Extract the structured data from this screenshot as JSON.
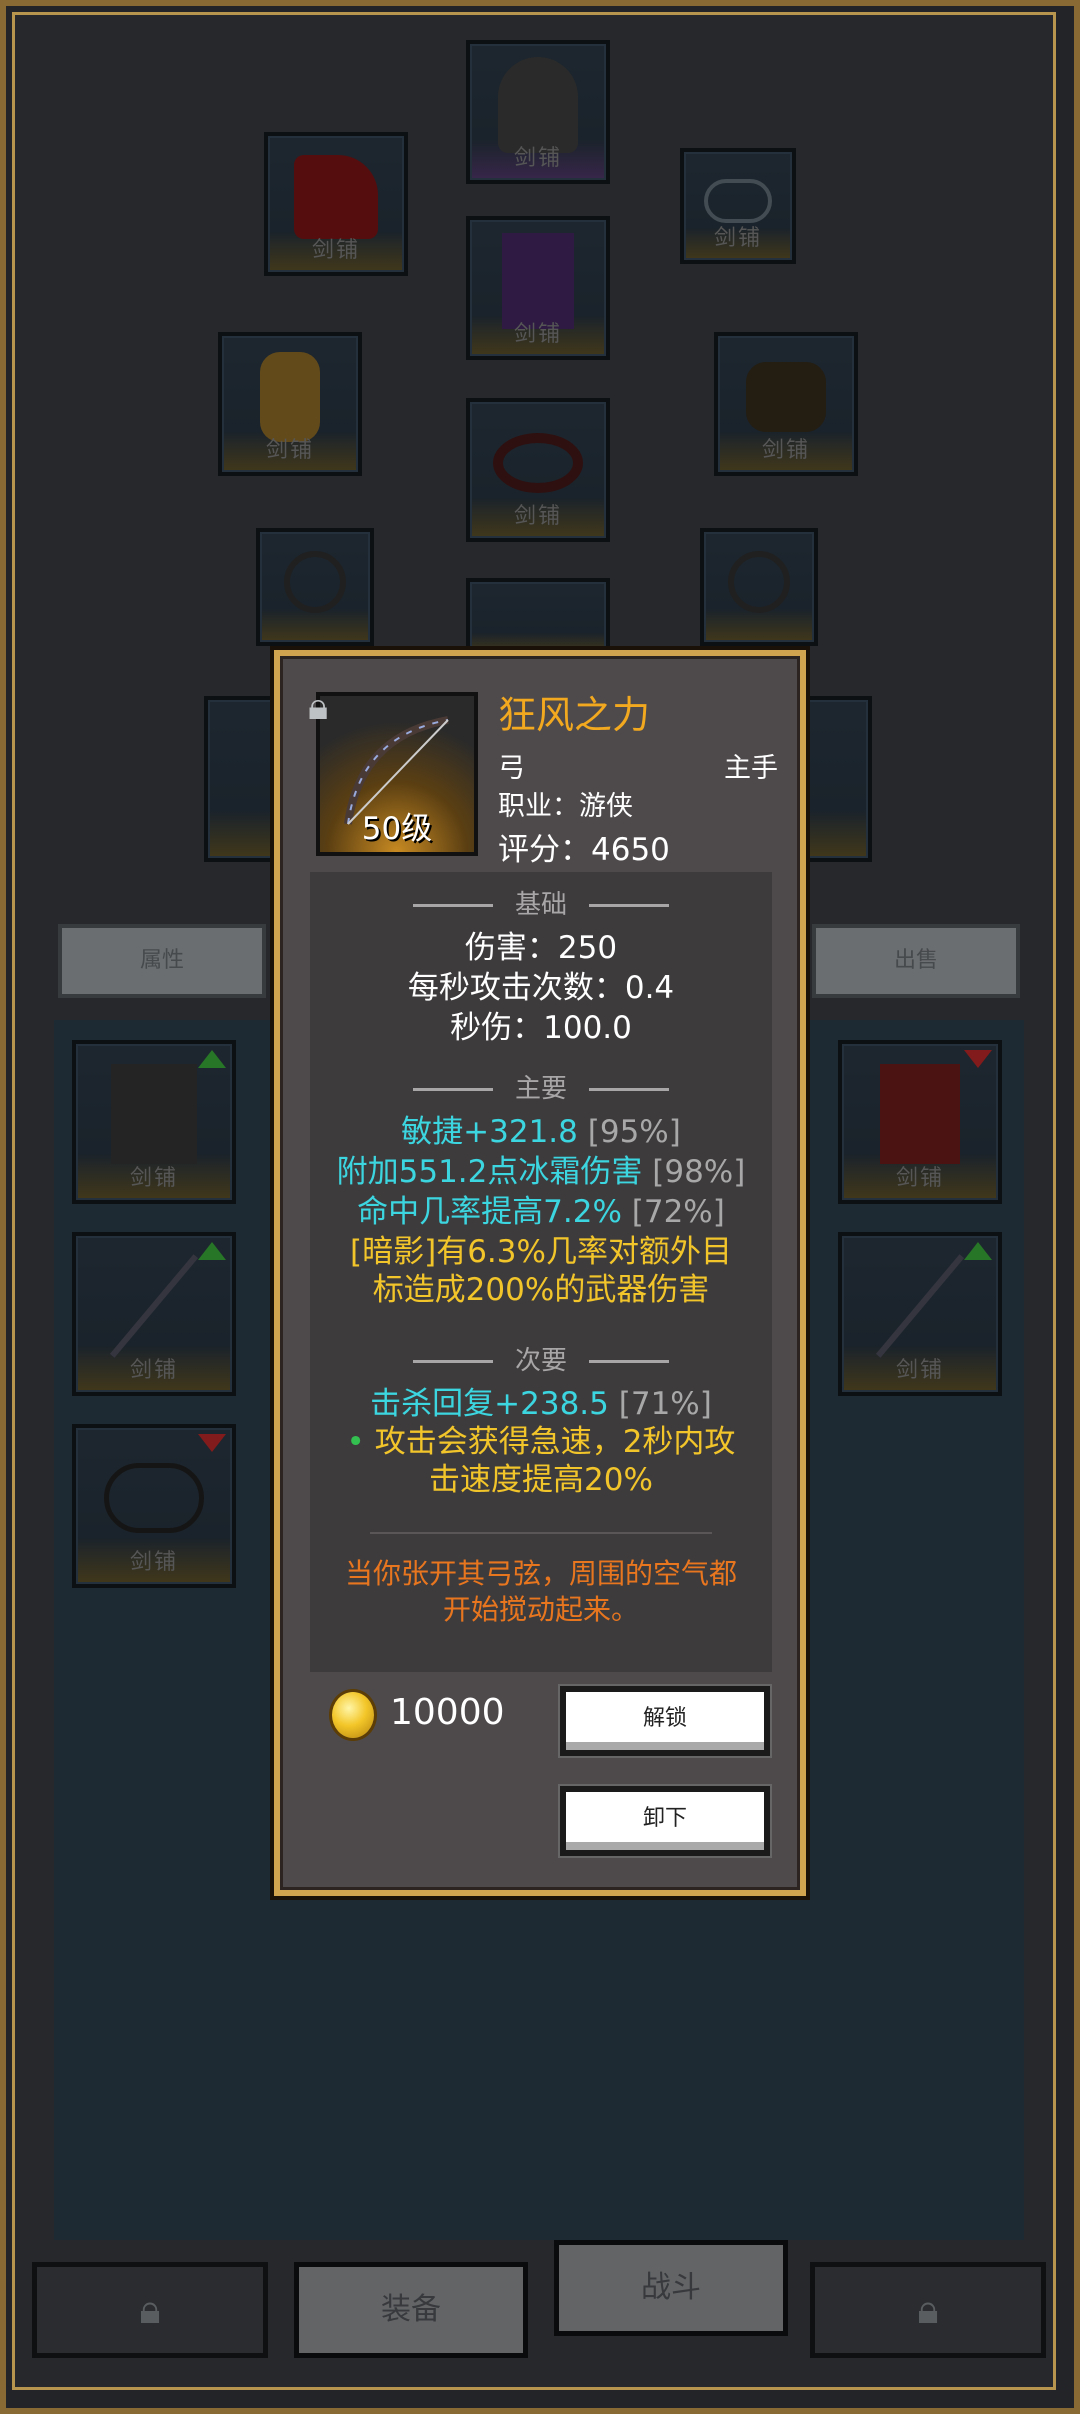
{
  "equipment_slots": {
    "slot_label": "剑铺",
    "top_helmet": "头盔",
    "arrows": {
      "up": "green",
      "down": "red"
    }
  },
  "side_tabs": {
    "left": "属性",
    "right": "出售"
  },
  "bottom_bar": {
    "equip": "装备",
    "battle": "战斗"
  },
  "item": {
    "name": "狂风之力",
    "type": "弓",
    "hand": "主手",
    "class_line": "职业：游侠",
    "score_line": "评分：4650",
    "level": "50级",
    "base_header": "基础",
    "base": [
      "伤害：250",
      "每秒攻击次数：0.4",
      "秒伤：100.0"
    ],
    "main_header": "主要",
    "main": [
      {
        "text": "敏捷+321.8",
        "pct": "[95%]"
      },
      {
        "text": "附加551.2点冰霜伤害",
        "pct": "[98%]"
      },
      {
        "text": "命中几率提高7.2%",
        "pct": "[72%]"
      }
    ],
    "special_line1": "[暗影]有6.3%几率对额外目",
    "special_line2": "标造成200%的武器伤害",
    "secondary_header": "次要",
    "secondary": {
      "text": "击杀回复+238.5",
      "pct": "[71%]"
    },
    "passive_bullet": "•",
    "passive_line1": "攻击会获得急速，2秒内攻",
    "passive_line2": "击速度提高20%",
    "flavor_line1": "当你张开其弓弦，周围的空气都",
    "flavor_line2": "开始搅动起来。",
    "price": "10000",
    "unlock_button": "解锁",
    "unequip_button": "卸下"
  },
  "colors": {
    "name": "#f2a81f",
    "main_stat": "#3bd6e0",
    "special": "#f2c52a",
    "flavor": "#e8761f",
    "dialog_border": "#d1a550"
  }
}
